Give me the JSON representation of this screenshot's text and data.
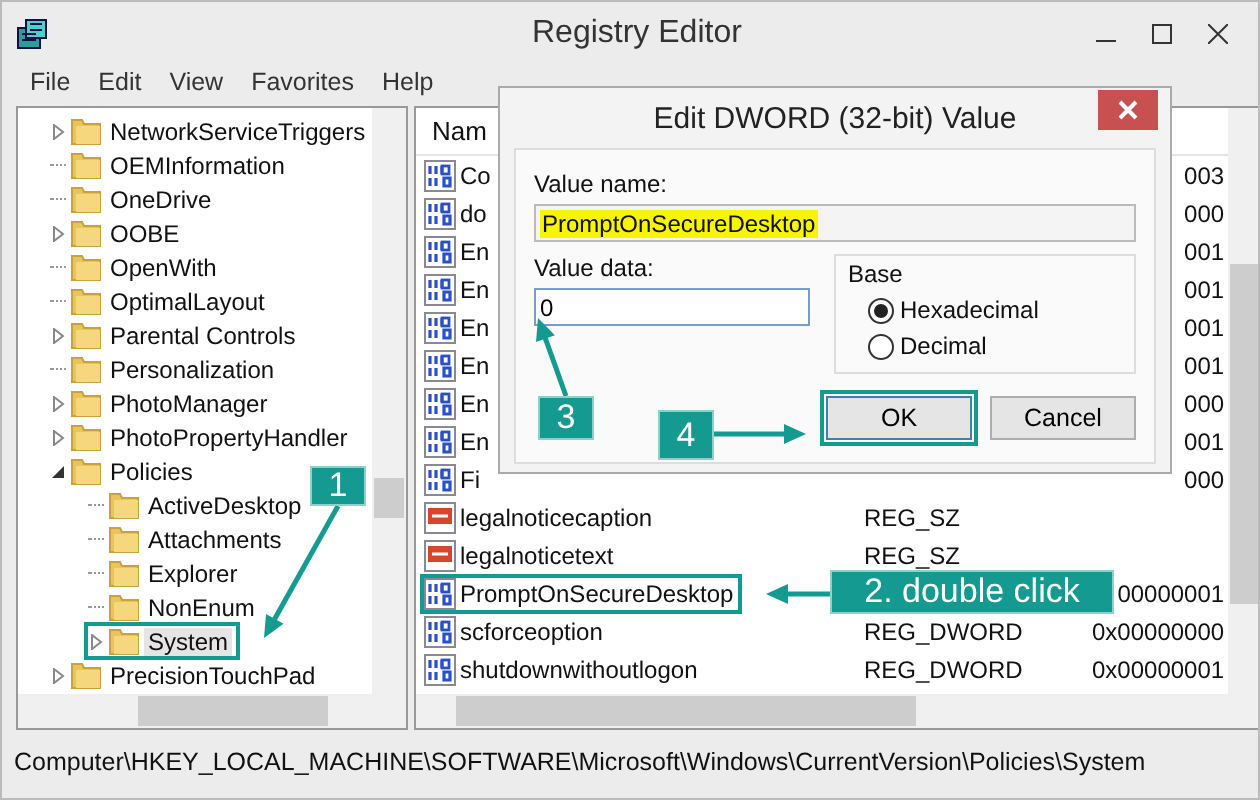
{
  "window": {
    "title": "Registry Editor"
  },
  "menu": [
    "File",
    "Edit",
    "View",
    "Favorites",
    "Help"
  ],
  "tree": [
    {
      "label": "NetworkServiceTriggers",
      "expanded": false,
      "selected": false
    },
    {
      "label": "OEMInformation",
      "selected": false
    },
    {
      "label": "OneDrive",
      "selected": false
    },
    {
      "label": "OOBE",
      "expanded": false,
      "selected": false
    },
    {
      "label": "OpenWith",
      "selected": false
    },
    {
      "label": "OptimalLayout",
      "selected": false
    },
    {
      "label": "Parental Controls",
      "expanded": false,
      "selected": false
    },
    {
      "label": "Personalization",
      "selected": false
    },
    {
      "label": "PhotoManager",
      "expanded": false,
      "selected": false
    },
    {
      "label": "PhotoPropertyHandler",
      "expanded": false,
      "selected": false
    },
    {
      "label": "Policies",
      "expanded": true,
      "selected": false,
      "children": [
        {
          "label": "ActiveDesktop",
          "selected": false
        },
        {
          "label": "Attachments",
          "selected": false
        },
        {
          "label": "Explorer",
          "selected": false
        },
        {
          "label": "NonEnum",
          "selected": false
        },
        {
          "label": "System",
          "expanded": false,
          "selected": true
        }
      ]
    },
    {
      "label": "PrecisionTouchPad",
      "expanded": false,
      "selected": false
    }
  ],
  "list": {
    "columns": [
      "Nam"
    ],
    "rows": [
      {
        "kind": "dword",
        "name": "Co",
        "data": "003"
      },
      {
        "kind": "dword",
        "name": "do",
        "data": "000"
      },
      {
        "kind": "dword",
        "name": "En",
        "data": "001"
      },
      {
        "kind": "dword",
        "name": "En",
        "data": "001"
      },
      {
        "kind": "dword",
        "name": "En",
        "data": "001"
      },
      {
        "kind": "dword",
        "name": "En",
        "data": "001"
      },
      {
        "kind": "dword",
        "name": "En",
        "data": "000"
      },
      {
        "kind": "dword",
        "name": "En",
        "data": "001"
      },
      {
        "kind": "dword",
        "name": "Fi",
        "data": "000"
      },
      {
        "kind": "string",
        "name": "legalnoticecaption",
        "type": "REG_SZ"
      },
      {
        "kind": "string",
        "name": "legalnoticetext",
        "type": "REG_SZ"
      },
      {
        "kind": "dword",
        "name": "PromptOnSecureDesktop",
        "data": "00000001"
      },
      {
        "kind": "dword",
        "name": "scforceoption",
        "type": "REG_DWORD",
        "data": "0x00000000"
      },
      {
        "kind": "dword",
        "name": "shutdownwithoutlogon",
        "type": "REG_DWORD",
        "data": "0x00000001"
      }
    ]
  },
  "status_bar": "Computer\\HKEY_LOCAL_MACHINE\\SOFTWARE\\Microsoft\\Windows\\CurrentVersion\\Policies\\System",
  "dialog": {
    "title": "Edit DWORD (32-bit) Value",
    "value_name_label": "Value name:",
    "value_name": "PromptOnSecureDesktop",
    "value_data_label": "Value data:",
    "value_data": "0",
    "base_label": "Base",
    "base_options": [
      {
        "label": "Hexadecimal",
        "selected": true
      },
      {
        "label": "Decimal",
        "selected": false
      }
    ],
    "buttons": [
      "OK",
      "Cancel"
    ]
  },
  "annotations": [
    "1",
    "2. double click",
    "3",
    "4"
  ]
}
